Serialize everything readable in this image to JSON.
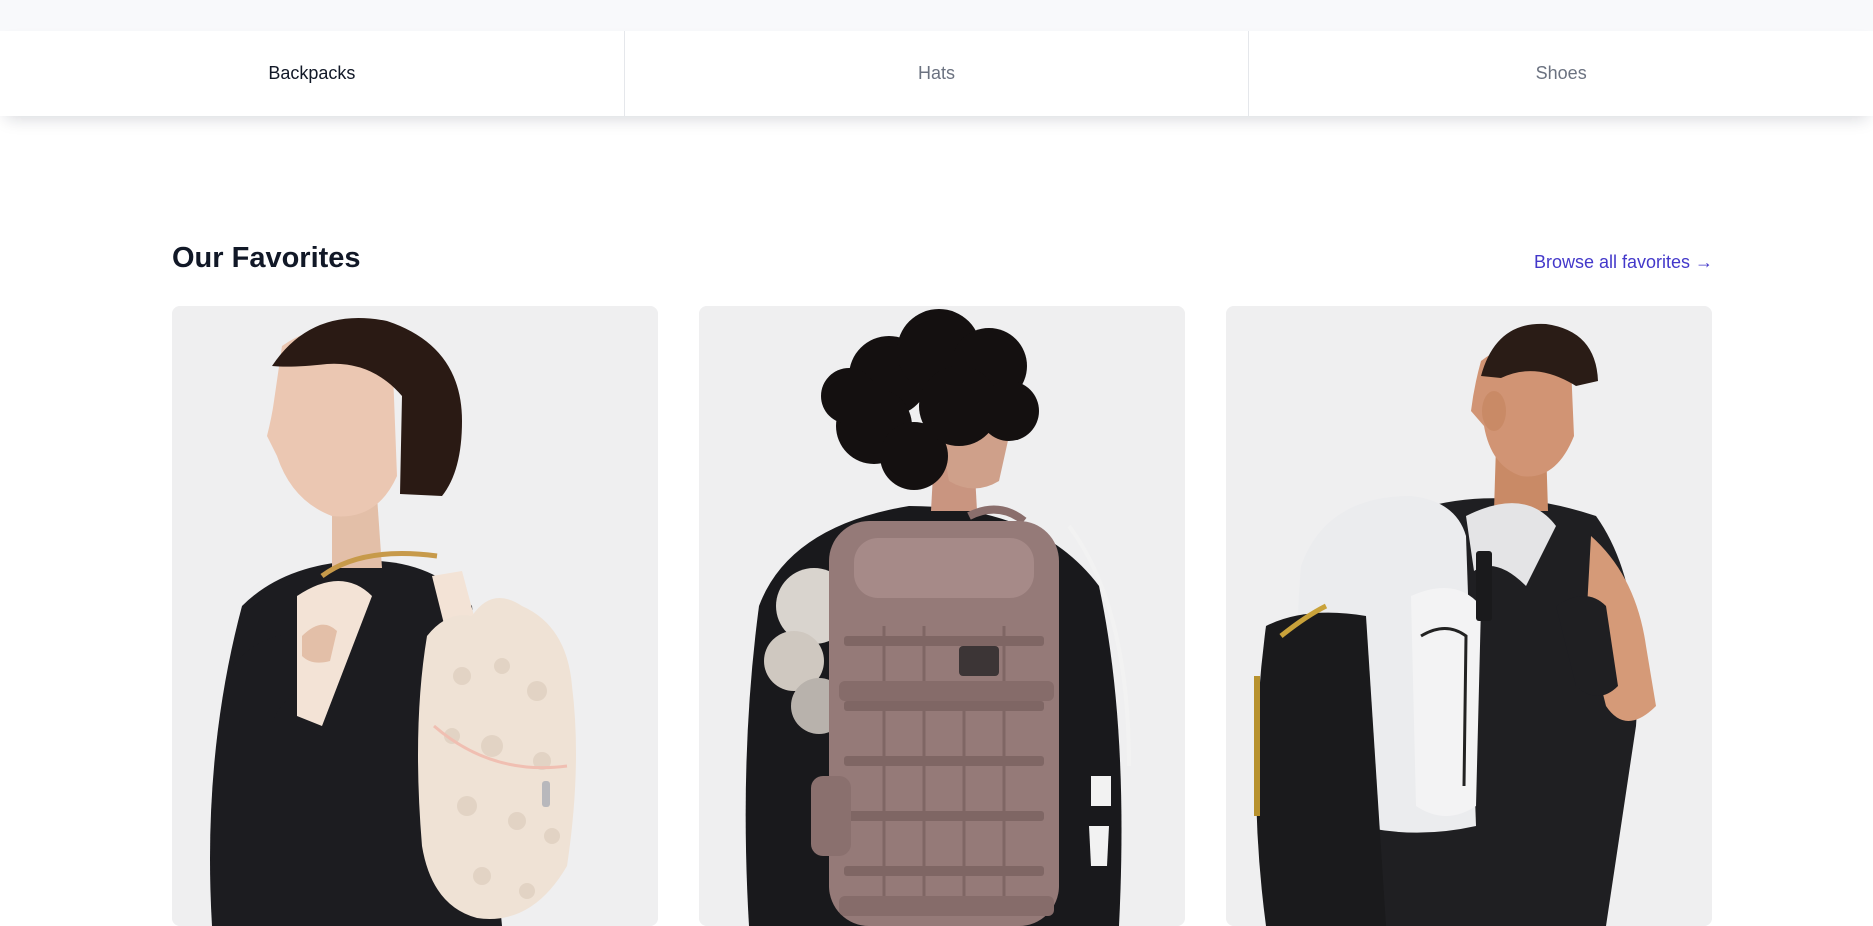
{
  "category_tabs": [
    {
      "label": "Backpacks",
      "active": true
    },
    {
      "label": "Hats",
      "active": false
    },
    {
      "label": "Shoes",
      "active": false
    }
  ],
  "favorites": {
    "title": "Our Favorites",
    "browse_link": "Browse all favorites →",
    "products": [
      {
        "image": "woman-with-cream-fleece-backpack-image"
      },
      {
        "image": "man-with-mauve-tactical-backpack-image"
      },
      {
        "image": "man-with-white-black-basketball-backpack-image"
      }
    ]
  },
  "colors": {
    "accent": "#4338ca",
    "heading": "#111827",
    "muted": "#6b7280",
    "card_bg": "#efeff0"
  }
}
